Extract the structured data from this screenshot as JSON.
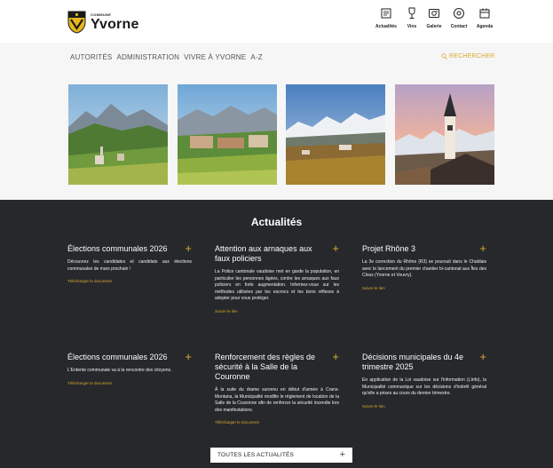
{
  "brand": {
    "pre": "COMMUNE",
    "name": "Yvorne"
  },
  "quick_links": [
    {
      "label": "Actualités",
      "icon": "newspaper-icon"
    },
    {
      "label": "Vins",
      "icon": "wine-glass-icon"
    },
    {
      "label": "Galerie",
      "icon": "gallery-icon"
    },
    {
      "label": "Contact",
      "icon": "at-icon"
    },
    {
      "label": "Agenda",
      "icon": "calendar-icon"
    }
  ],
  "nav": {
    "items": [
      "AUTORITÉS",
      "ADMINISTRATION",
      "VIVRE À YVORNE",
      "A-Z"
    ],
    "search_label": "RECHERCHER"
  },
  "news": {
    "title": "Actualités",
    "cards": [
      {
        "title": "Élections communales 2026",
        "body": "Découvrez les candidates et candidats aux élections communales de mars prochain !",
        "link": "Télécharger le document"
      },
      {
        "title": "Attention aux arnaques aux faux policiers",
        "body": "La Police cantonale vaudoise met en garde la population, en particulier les personnes âgées, contre les arnaques aux faux policiers en forte augmentation. Informez-vous sur les méthodes utilisées par les escrocs et les bons réflexes à adopter pour vous protéger.",
        "link": "Suivre le lien"
      },
      {
        "title": "Projet Rhône 3",
        "body": "La 3e correction du Rhône (R3) se poursuit dans le Chablais avec le lancement du premier chantier bi-cantonal aux Îles des Clous (Yvorne et Vouvry).",
        "link": "Suivre le lien"
      },
      {
        "title": "Élections communales 2026",
        "body": "L'Entente communale va à la rencontre des citoyens.",
        "link": "Télécharger le document"
      },
      {
        "title": "Renforcement des règles de sécurité à la Salle de la Couronne",
        "body": "À la suite du drame survenu en début d'année à Crans-Montana, la Municipalité modifie le règlement de location de la Salle de la Couronne afin de renforcer la sécurité incendie lors des manifestations.",
        "link": "Télécharger le document"
      },
      {
        "title": "Décisions municipales du 4e trimestre 2025",
        "body": "En application de la Loi vaudoise sur l'information (LInfo), la Municipalité communique sur les décisions d'intérêt général qu'elle a prises au cours du dernier trimestre.",
        "link": "Suivre le lien"
      }
    ],
    "all_button": "TOUTES LES ACTUALITÉS",
    "plus_symbol": "+"
  },
  "colors": {
    "accent": "#d9a92e",
    "dark": "#26282c"
  }
}
